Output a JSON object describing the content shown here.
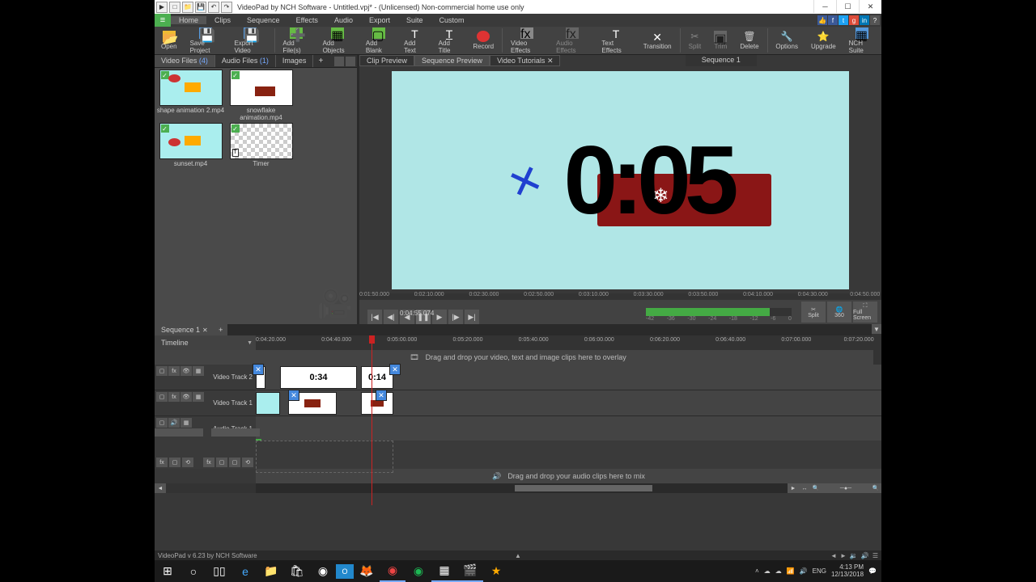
{
  "title": "VideoPad by NCH Software - Untitled.vpj* - (Unlicensed) Non-commercial home use only",
  "menu": [
    "Home",
    "Clips",
    "Sequence",
    "Effects",
    "Audio",
    "Export",
    "Suite",
    "Custom"
  ],
  "toolbar": {
    "open": "Open",
    "save": "Save Project",
    "export": "Export Video",
    "addfiles": "Add File(s)",
    "addobjects": "Add Objects",
    "addblank": "Add Blank",
    "addtext": "Add Text",
    "addtitle": "Add Title",
    "record": "Record",
    "videofx": "Video Effects",
    "audiofx": "Audio Effects",
    "textfx": "Text Effects",
    "transition": "Transition",
    "split": "Split",
    "trim": "Trim",
    "delete": "Delete",
    "options": "Options",
    "upgrade": "Upgrade",
    "suite": "NCH Suite"
  },
  "bins": {
    "tabs": {
      "video": "Video Files",
      "video_ct": "(4)",
      "audio": "Audio Files",
      "audio_ct": "(1)",
      "images": "Images"
    },
    "items": [
      {
        "name": "shape animation 2.mp4"
      },
      {
        "name": "snowflake animation.mp4"
      },
      {
        "name": "sunset.mp4"
      },
      {
        "name": "Timer"
      }
    ]
  },
  "preview": {
    "tabs": {
      "clip": "Clip Preview",
      "seq": "Sequence Preview",
      "tut": "Video Tutorials"
    },
    "seq_label": "Sequence 1",
    "timer_text": "0:05",
    "mini_ticks": [
      "0:01:50.000",
      "0:02:10.000",
      "0:02:30.000",
      "0:02:50.000",
      "0:03:10.000",
      "0:03:30.000",
      "0:03:50.000",
      "0:04:10.000",
      "0:04:30.000",
      "0:04:50.000"
    ],
    "playback_time": "0:04:55.074",
    "audio_ticks": [
      "-42",
      "-36",
      "-30",
      "-24",
      "-18",
      "-12",
      "-6",
      "0"
    ],
    "btn_split": "Split",
    "btn_360": "360",
    "btn_full": "Full Screen"
  },
  "timeline": {
    "tab": "Sequence 1",
    "label": "Timeline",
    "ruler": [
      "0:04:20.000",
      "0:04:40.000",
      "0:05:00.000",
      "0:05:20.000",
      "0:05:40.000",
      "0:06:00.000",
      "0:06:20.000",
      "0:06:40.000",
      "0:07:00.000",
      "0:07:20.000"
    ],
    "overlay_hint": "Drag and drop your video, text and image clips here to overlay",
    "audio_hint": "Drag and drop your audio clips here to mix",
    "track_v2": "Video Track 2",
    "track_v1": "Video Track 1",
    "track_a1": "Audio Track 1",
    "clip_034": "0:34",
    "clip_014": "0:14"
  },
  "status": {
    "version": "VideoPad v 6.23 by NCH Software",
    "arrow": "▲"
  },
  "taskbar": {
    "lang": "ENG",
    "time": "4:13 PM",
    "date": "12/13/2018"
  }
}
